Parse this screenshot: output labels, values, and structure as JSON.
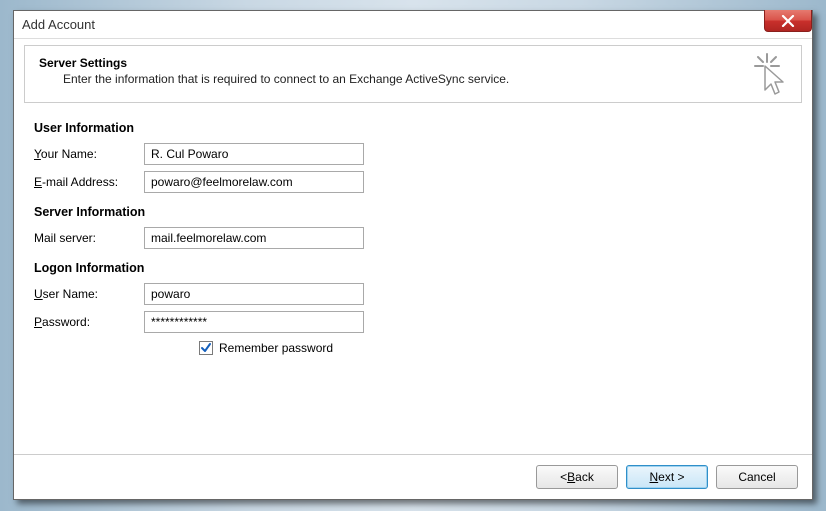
{
  "window": {
    "title": "Add Account"
  },
  "header": {
    "title": "Server Settings",
    "subtitle": "Enter the information that is required to connect to an Exchange ActiveSync service."
  },
  "sections": {
    "user_info_title": "User Information",
    "server_info_title": "Server Information",
    "logon_info_title": "Logon Information"
  },
  "fields": {
    "your_name": {
      "label_pre": "Y",
      "label_rest": "our Name:",
      "value": "R. Cul Powaro"
    },
    "email": {
      "label_pre": "E",
      "label_rest": "-mail Address:",
      "value": "powaro@feelmorelaw.com"
    },
    "mail_server": {
      "label": "Mail server:",
      "value": "mail.feelmorelaw.com"
    },
    "user_name": {
      "label_pre": "U",
      "label_rest": "ser Name:",
      "value": "powaro"
    },
    "password": {
      "label_pre": "P",
      "label_rest": "assword:",
      "value": "************"
    },
    "remember": {
      "label_pre": "R",
      "label_rest": "emember password",
      "checked": true
    }
  },
  "buttons": {
    "back": {
      "pre": "< ",
      "u": "B",
      "rest": "ack"
    },
    "next": {
      "u": "N",
      "rest": "ext >"
    },
    "cancel": {
      "label": "Cancel"
    }
  }
}
